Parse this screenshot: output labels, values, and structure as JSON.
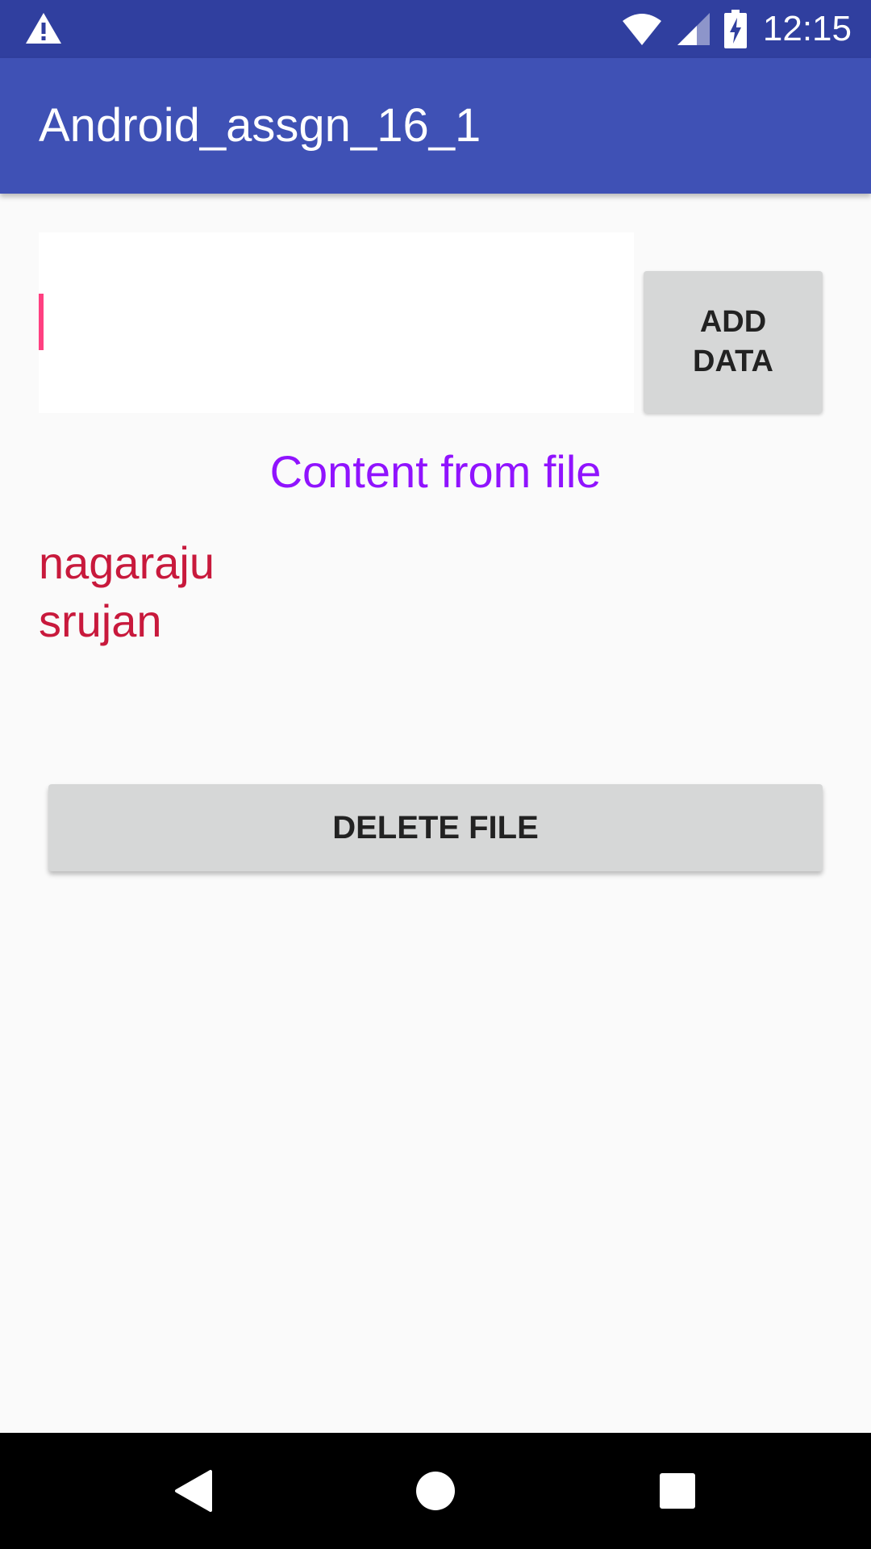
{
  "status_bar": {
    "time": "12:15",
    "icons": [
      "warning-icon",
      "wifi-icon",
      "signal-icon",
      "battery-charging-icon"
    ]
  },
  "app_bar": {
    "title": "Android_assgn_16_1"
  },
  "input": {
    "value": "",
    "placeholder": ""
  },
  "add_button": {
    "line1": "ADD",
    "line2": "DATA"
  },
  "content_heading": "Content from file",
  "file_content": [
    "nagaraju",
    "srujan"
  ],
  "delete_button": {
    "label": "DELETE FILE"
  },
  "nav_bar": {
    "icons": [
      "back-icon",
      "home-icon",
      "recents-icon"
    ]
  },
  "colors": {
    "status_bar": "#303f9f",
    "app_bar": "#3f51b5",
    "accent": "#ff4081",
    "heading": "#9013fe",
    "content": "#c8193c",
    "button": "#d6d7d7"
  }
}
